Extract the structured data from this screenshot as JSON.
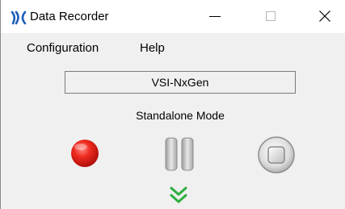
{
  "window": {
    "title": "Data Recorder",
    "app_icon": "data-recorder-app-icon",
    "controls": {
      "minimize_icon": "minimize-icon",
      "maximize_icon": "maximize-icon",
      "close_icon": "close-icon"
    }
  },
  "menu": {
    "items": [
      {
        "label": "Configuration"
      },
      {
        "label": "Help"
      }
    ]
  },
  "device": {
    "name": "VSI-NxGen"
  },
  "mode": {
    "label": "Standalone Mode"
  },
  "controls": {
    "record_icon": "record-icon",
    "pause_icon": "pause-icon",
    "stop_icon": "stop-icon",
    "expand_icon": "double-chevron-down-icon"
  },
  "colors": {
    "record": "#e8231c",
    "expand_chevron": "#2fae3f",
    "background": "#f0f0f0"
  }
}
